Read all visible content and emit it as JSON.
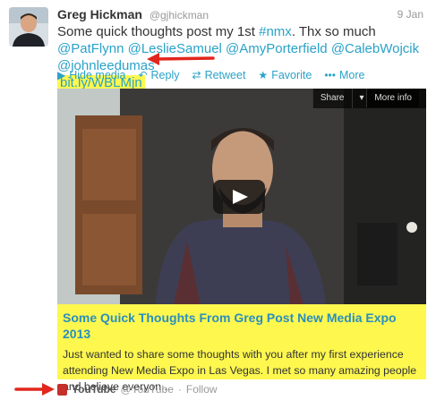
{
  "tweet": {
    "author_name": "Greg Hickman",
    "author_handle": "@gjhickman",
    "date": "9 Jan",
    "segments": [
      {
        "text": "Some quick thoughts post my 1st ",
        "link": false
      },
      {
        "text": "#nmx",
        "link": true
      },
      {
        "text": ". Thx so much ",
        "link": false
      },
      {
        "text": "@PatFlynn",
        "link": true
      },
      {
        "text": " ",
        "link": false
      },
      {
        "text": "@LeslieSamuel",
        "link": true
      },
      {
        "text": " ",
        "link": false
      },
      {
        "text": "@AmyPorterfield",
        "link": true
      },
      {
        "text": " ",
        "link": false
      },
      {
        "text": "@CalebWojcik",
        "link": true
      },
      {
        "text": " ",
        "link": false
      },
      {
        "text": "@johnleedumas",
        "link": true
      }
    ],
    "short_link": "bit.ly/WBLMjn"
  },
  "actions": {
    "hide_media": "Hide media",
    "reply": "Reply",
    "retweet": "Retweet",
    "favorite": "Favorite",
    "more": "More"
  },
  "media": {
    "share_label": "Share",
    "more_info_label": "More info"
  },
  "card": {
    "title": "Some Quick Thoughts From Greg Post New Media Expo 2013",
    "description": "Just wanted to share some thoughts with you after my first experience attending New Media Expo in Las Vegas. I met so many amazing people and believe everyon..."
  },
  "footer": {
    "site": "YouTube",
    "handle": "@YouTube",
    "separator": "·",
    "follow": "Follow"
  },
  "colors": {
    "link": "#2aa2c8",
    "highlight": "#fdf74e",
    "arrow": "#e2261c"
  }
}
